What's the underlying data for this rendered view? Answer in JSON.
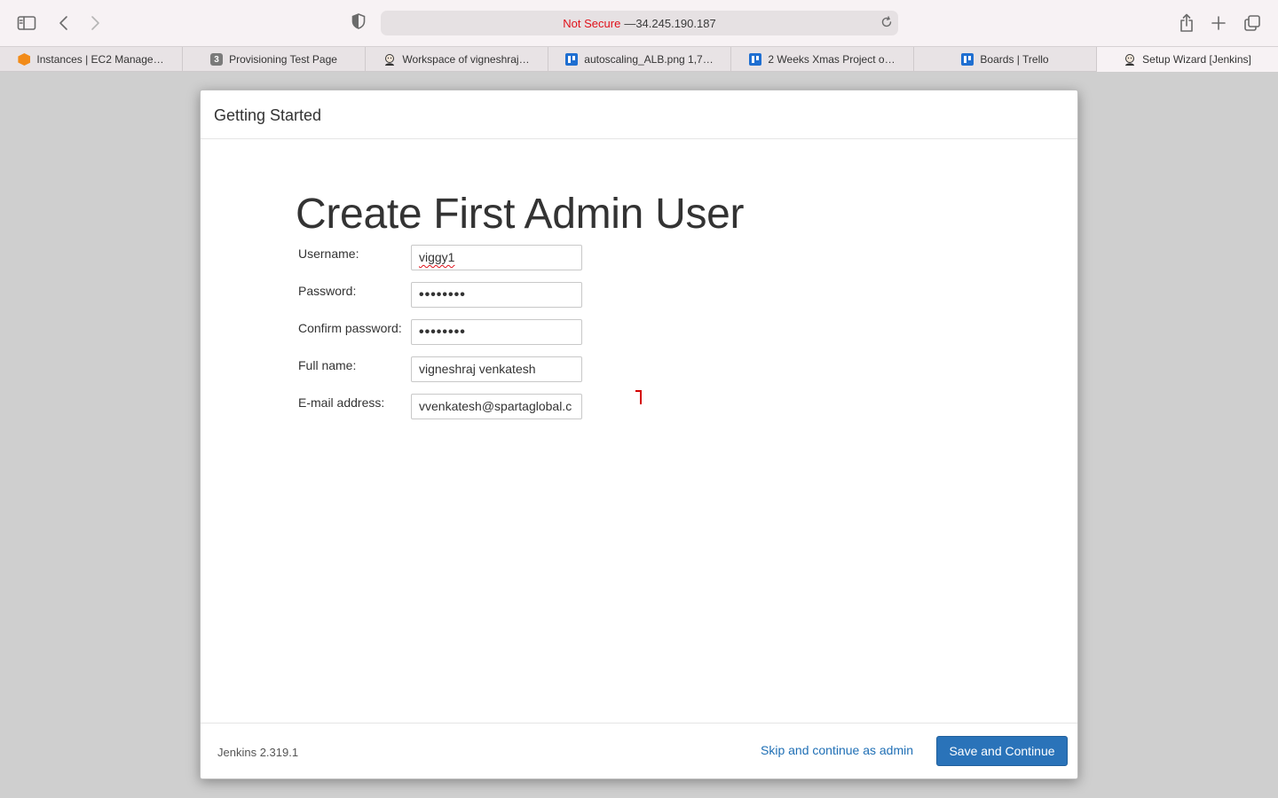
{
  "browser": {
    "address": {
      "security": "Not Secure",
      "separator": " — ",
      "host": "34.245.190.187"
    },
    "tabs": [
      {
        "label": "Instances | EC2 Manage…",
        "icon": "aws-ec2-icon"
      },
      {
        "label": "Provisioning Test Page",
        "icon": "number-3-icon",
        "badge": "3"
      },
      {
        "label": "Workspace of vigneshraj…",
        "icon": "jenkins-icon"
      },
      {
        "label": "autoscaling_ALB.png 1,7…",
        "icon": "trello-icon"
      },
      {
        "label": "2 Weeks Xmas Project o…",
        "icon": "trello-icon"
      },
      {
        "label": "Boards | Trello",
        "icon": "trello-icon"
      },
      {
        "label": "Setup Wizard [Jenkins]",
        "icon": "jenkins-icon",
        "active": true
      }
    ]
  },
  "wizard": {
    "header": "Getting Started",
    "title": "Create First Admin User",
    "fields": {
      "username": {
        "label": "Username:",
        "value": "viggy1"
      },
      "password": {
        "label": "Password:",
        "value": "••••••••"
      },
      "confirm_password": {
        "label": "Confirm password:",
        "value": "••••••••"
      },
      "full_name": {
        "label": "Full name:",
        "value": "vigneshraj venkatesh"
      },
      "email": {
        "label": "E-mail address:",
        "value": "vvenkatesh@spartaglobal.c"
      }
    },
    "footer": {
      "version": "Jenkins 2.319.1",
      "skip_label": "Skip and continue as admin",
      "save_label": "Save and Continue"
    }
  },
  "colors": {
    "primary_button": "#2a73b9",
    "link": "#1f6fb5",
    "not_secure": "#e0121b"
  }
}
